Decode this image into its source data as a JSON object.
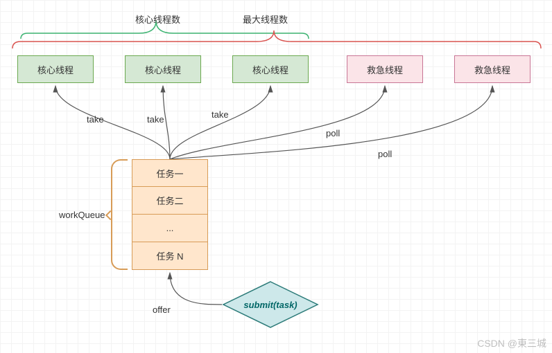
{
  "topLabels": {
    "core": "核心线程数",
    "max": "最大线程数"
  },
  "threads": {
    "core": [
      "核心线程",
      "核心线程",
      "核心线程"
    ],
    "emergency": [
      "救急线程",
      "救急线程"
    ]
  },
  "arrowLabels": {
    "take": "take",
    "poll": "poll",
    "offer": "offer"
  },
  "queue": {
    "label": "workQueue",
    "tasks": [
      "任务一",
      "任务二",
      "...",
      "任务 N"
    ]
  },
  "submit": "submit(task)",
  "watermark": "CSDN @東三城"
}
